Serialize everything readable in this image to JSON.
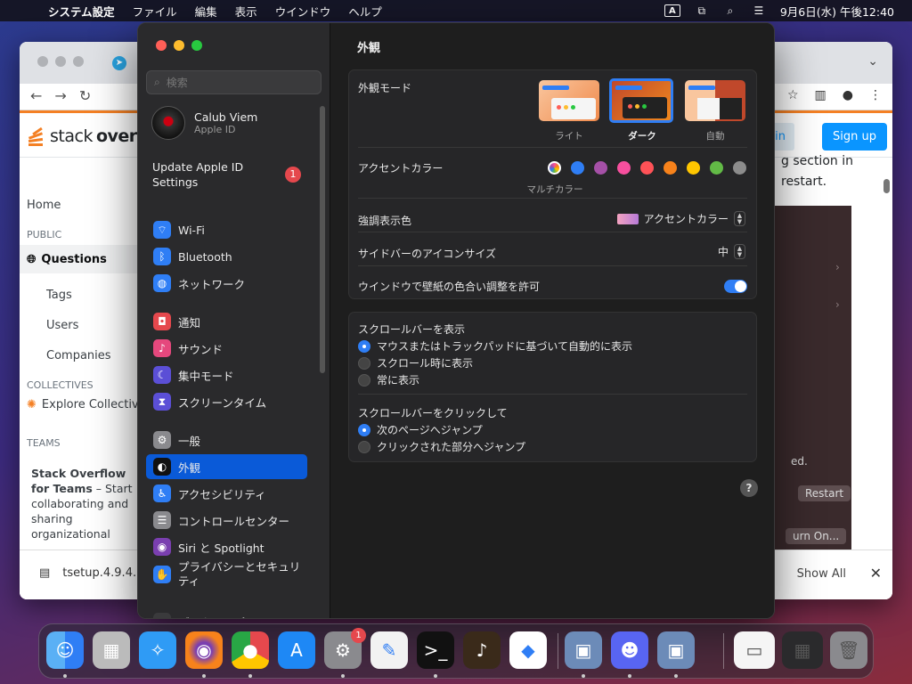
{
  "menubar": {
    "app_name": "システム設定",
    "items": [
      "ファイル",
      "編集",
      "表示",
      "ウインドウ",
      "ヘルプ"
    ],
    "input_indicator": "A",
    "clock": "9月6日(水) 午後12:40"
  },
  "browser": {
    "logo_text_a": "stack",
    "logo_text_b": "overfl",
    "login_label": "in",
    "signup_label": "Sign up",
    "nav_home": "Home",
    "section_public": "PUBLIC",
    "nav_questions": "Questions",
    "nav_tags": "Tags",
    "nav_users": "Users",
    "nav_companies": "Companies",
    "section_collectives": "COLLECTIVES",
    "nav_explore": "Explore Collectiv",
    "section_teams": "TEAMS",
    "teams_title": "Stack Overflow for Teams",
    "teams_text_1": " – Start",
    "teams_text_2": "collaborating and",
    "teams_text_3": "sharing",
    "teams_text_4": "organizational",
    "content_line_1": "g section in",
    "content_line_2": "restart.",
    "dp_text": "ed.",
    "dp_restart": "Restart",
    "dp_turnon": "urn On...",
    "download_file": "tsetup.4.9.4.",
    "download_showall": "Show All"
  },
  "settings": {
    "search_placeholder": "検索",
    "account_name": "Calub Viem",
    "account_sub": "Apple ID",
    "update_line1": "Update Apple ID",
    "update_line2": "Settings",
    "update_badge": "1",
    "sidebar": [
      {
        "label": "Wi-Fi",
        "icon": "wifi-icon",
        "color": "#2f7ef5",
        "glyph": "⌔"
      },
      {
        "label": "Bluetooth",
        "icon": "bluetooth-icon",
        "color": "#2f7ef5",
        "glyph": "ᛒ"
      },
      {
        "label": "ネットワーク",
        "icon": "network-icon",
        "color": "#2f7ef5",
        "glyph": "◍"
      },
      {
        "label": "通知",
        "icon": "notifications-icon",
        "color": "#e5484d",
        "glyph": "◘"
      },
      {
        "label": "サウンド",
        "icon": "sound-icon",
        "color": "#e5487d",
        "glyph": "♪"
      },
      {
        "label": "集中モード",
        "icon": "focus-icon",
        "color": "#5b4fd6",
        "glyph": "☾"
      },
      {
        "label": "スクリーンタイム",
        "icon": "screen-time-icon",
        "color": "#5b4fd6",
        "glyph": "⧗"
      },
      {
        "label": "一般",
        "icon": "general-icon",
        "color": "#8a8a8e",
        "glyph": "⚙"
      },
      {
        "label": "外観",
        "icon": "appearance-icon",
        "color": "#111111",
        "glyph": "◐"
      },
      {
        "label": "アクセシビリティ",
        "icon": "accessibility-icon",
        "color": "#2f7ef5",
        "glyph": "♿"
      },
      {
        "label": "コントロールセンター",
        "icon": "control-center-icon",
        "color": "#8a8a8e",
        "glyph": "☰"
      },
      {
        "label": "Siri と Spotlight",
        "icon": "siri-icon",
        "color": "#7a3fb0",
        "glyph": "◉"
      },
      {
        "label": "プライバシーとセキュリティ",
        "icon": "privacy-icon",
        "color": "#2f7ef5",
        "glyph": "✋"
      },
      {
        "label": "デスクトップと Dock",
        "icon": "desktop-dock-icon",
        "color": "#3a3a3c",
        "glyph": "▭"
      }
    ],
    "main": {
      "title": "外観",
      "appearance_mode_label": "外観モード",
      "modes": [
        "ライト",
        "ダーク",
        "自動"
      ],
      "accent_label": "アクセントカラー",
      "accent_colors": [
        "#8e8e93",
        "#2f7ef5",
        "#a550a7",
        "#f74f9e",
        "#ff5257",
        "#f7821b",
        "#ffc600",
        "#62ba46",
        "#8c8c8c"
      ],
      "accent_multicolor": "マルチカラー",
      "highlight_label": "強調表示色",
      "highlight_value": "アクセントカラー",
      "sidebar_icon_label": "サイドバーのアイコンサイズ",
      "sidebar_icon_value": "中",
      "wallpaper_tint_label": "ウインドウで壁紙の色合い調整を許可",
      "scrollbar_show_label": "スクロールバーを表示",
      "scrollbar_show_options": [
        "マウスまたはトラックパッドに基づいて自動的に表示",
        "スクロール時に表示",
        "常に表示"
      ],
      "scrollbar_click_label": "スクロールバーをクリックして",
      "scrollbar_click_options": [
        "次のページへジャンプ",
        "クリックされた部分へジャンプ"
      ],
      "help": "?"
    }
  },
  "dock": {
    "apps": [
      "Finder",
      "Launchpad",
      "Safari",
      "Firefox",
      "Chrome",
      "App Store",
      "システム設定",
      "TextEdit",
      "Terminal",
      "GarageBand",
      "VS Code",
      "VirtualBox",
      "Discord",
      "VirtualBox VM"
    ],
    "settings_badge": "1"
  }
}
